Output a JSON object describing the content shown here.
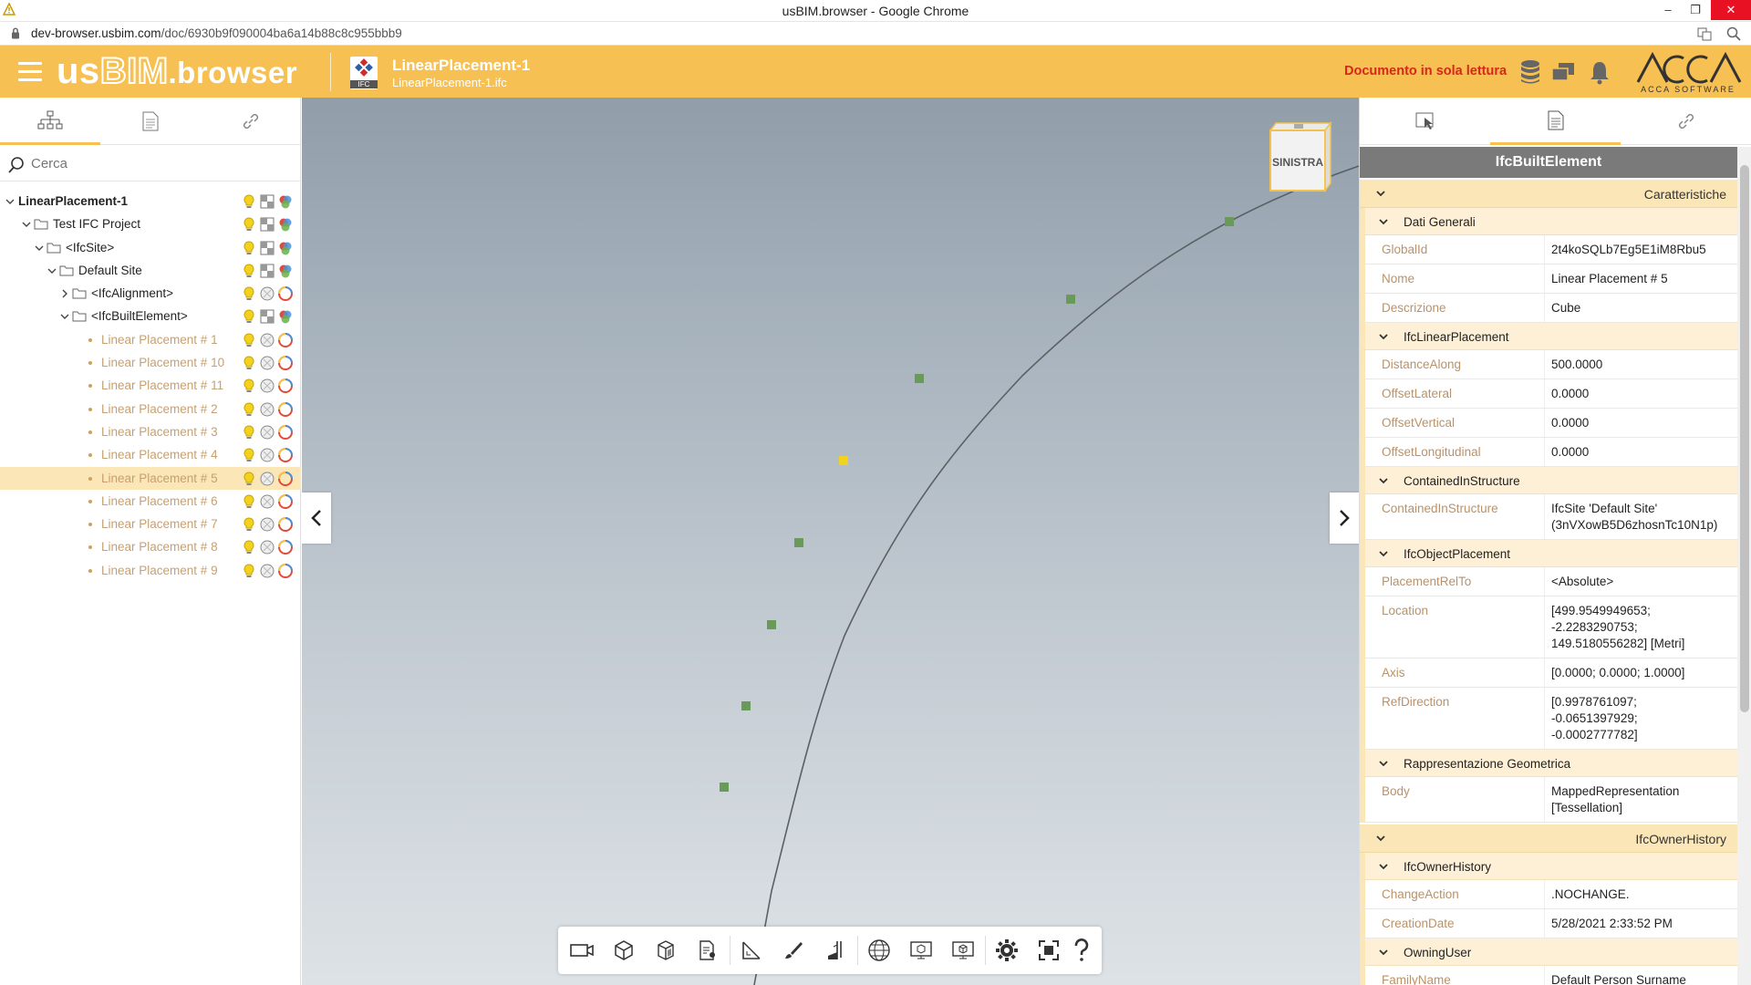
{
  "browser": {
    "window_title": "usBIM.browser - Google Chrome",
    "url_host": "dev-browser.usbim.com",
    "url_path": "/doc/6930b9f090004ba6a14b88c8c955bbb9"
  },
  "header": {
    "logo_us": "us",
    "logo_bim": "BIM",
    "logo_browser": ".browser",
    "ifc_badge": "IFC",
    "doc_title": "LinearPlacement-1",
    "doc_file": "LinearPlacement-1.ifc",
    "readonly_label": "Documento in sola lettura",
    "brand": "ACCA",
    "brand_sub": "ACCA SOFTWARE"
  },
  "left_panel": {
    "search_placeholder": "Cerca",
    "tree": [
      {
        "label": "LinearPlacement-1",
        "level": 0
      },
      {
        "label": "Test IFC Project",
        "level": 1
      },
      {
        "label": "<IfcSite>",
        "level": 2
      },
      {
        "label": "Default Site",
        "level": 3
      },
      {
        "label": "<IfcAlignment>",
        "level": 4
      },
      {
        "label": "<IfcBuiltElement>",
        "level": 4
      },
      {
        "label": "Linear Placement # 1",
        "level": 5
      },
      {
        "label": "Linear Placement # 10",
        "level": 5
      },
      {
        "label": "Linear Placement # 11",
        "level": 5
      },
      {
        "label": "Linear Placement # 2",
        "level": 5
      },
      {
        "label": "Linear Placement # 3",
        "level": 5
      },
      {
        "label": "Linear Placement # 4",
        "level": 5
      },
      {
        "label": "Linear Placement # 5",
        "level": 5,
        "selected": true
      },
      {
        "label": "Linear Placement # 6",
        "level": 5
      },
      {
        "label": "Linear Placement # 7",
        "level": 5
      },
      {
        "label": "Linear Placement # 8",
        "level": 5
      },
      {
        "label": "Linear Placement # 9",
        "level": 5
      }
    ]
  },
  "viewport": {
    "navcube_label": "SINISTRA",
    "toolbar_icons": [
      "camera-icon",
      "cube-icon",
      "section-box-icon",
      "annotation-icon",
      "measure-icon",
      "brush-icon",
      "cut-plane-icon",
      "globe-icon",
      "model-view-icon",
      "model-compare-icon",
      "settings-icon",
      "fit-view-icon",
      "help-icon"
    ]
  },
  "right_panel": {
    "title": "IfcBuiltElement",
    "sections": {
      "caratteristiche": "Caratteristiche",
      "dati_generali": "Dati Generali",
      "globalid_k": "GlobalId",
      "globalid_v": "2t4koSQLb7Eg5E1iM8Rbu5",
      "nome_k": "Nome",
      "nome_v": "Linear Placement # 5",
      "descr_k": "Descrizione",
      "descr_v": "Cube",
      "ifclinear": "IfcLinearPlacement",
      "dist_k": "DistanceAlong",
      "dist_v": "500.0000",
      "offlat_k": "OffsetLateral",
      "offlat_v": "0.0000",
      "offvert_k": "OffsetVertical",
      "offvert_v": "0.0000",
      "offlong_k": "OffsetLongitudinal",
      "offlong_v": "0.0000",
      "contained": "ContainedInStructure",
      "contained_k": "ContainedInStructure",
      "contained_v1": "IfcSite 'Default Site'",
      "contained_v2": "(3nVXowB5D6zhosnTc10N1p)",
      "objplacement": "IfcObjectPlacement",
      "relto_k": "PlacementRelTo",
      "relto_v": "<Absolute>",
      "loc_k": "Location",
      "loc_v1": "[499.9549949653;",
      "loc_v2": "-2.2283290753;",
      "loc_v3": "149.5180556282] [Metri]",
      "axis_k": "Axis",
      "axis_v": "[0.0000; 0.0000; 1.0000]",
      "refdir_k": "RefDirection",
      "refdir_v1": "[0.9978761097;",
      "refdir_v2": "-0.0651397929;",
      "refdir_v3": "-0.0002777782]",
      "rappr": "Rappresentazione Geometrica",
      "body_k": "Body",
      "body_v1": "MappedRepresentation",
      "body_v2": "[Tessellation]",
      "owner": "IfcOwnerHistory",
      "ownerhist": "IfcOwnerHistory",
      "change_k": "ChangeAction",
      "change_v": ".NOCHANGE.",
      "created_k": "CreationDate",
      "created_v": "5/28/2021 2:33:52 PM",
      "owning": "OwningUser",
      "family_k": "FamilyName",
      "family_v": "Default Person Surname"
    }
  },
  "colors": {
    "header_bg": "#f6c053",
    "readonly_red": "#d9261c",
    "marker_green": "#6a9a5a",
    "marker_selected": "#f2d21f"
  }
}
